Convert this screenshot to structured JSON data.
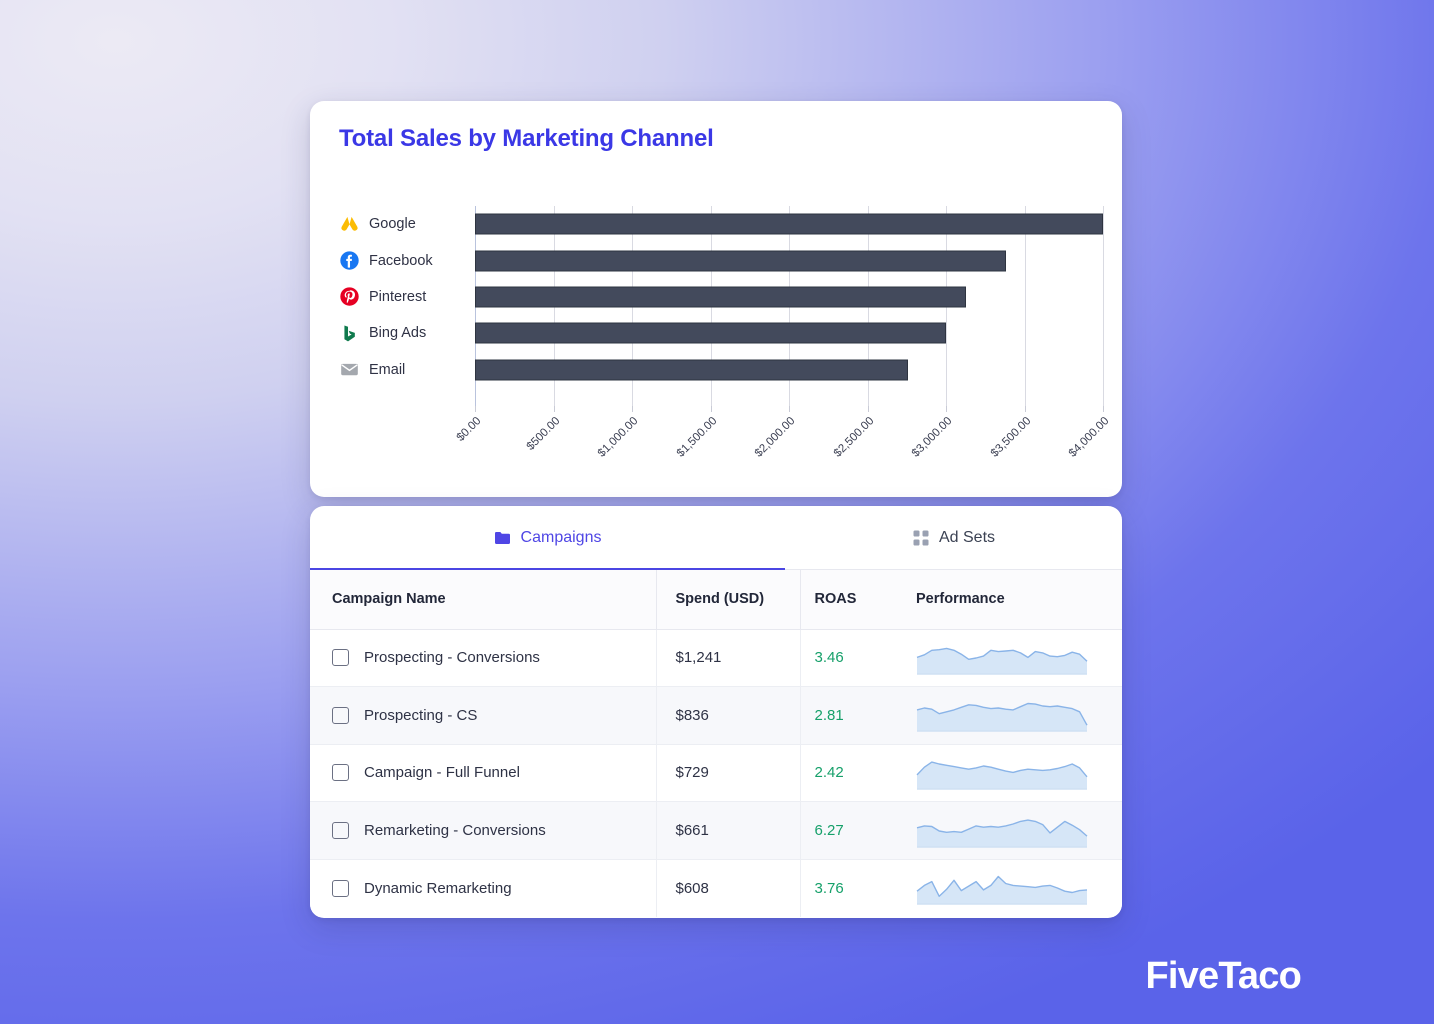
{
  "brand": {
    "logo_text": "FiveTaco"
  },
  "theme": {
    "accent": "#4b46e3",
    "title_color": "#3b38e6",
    "bar_color": "#434a5c",
    "roas_color": "#16a06a",
    "spark_stroke": "#8ab4e8",
    "spark_fill": "#d6e6f7"
  },
  "chart_card": {
    "title": "Total Sales by Marketing Channel"
  },
  "chart_data": {
    "type": "bar",
    "orientation": "horizontal",
    "title": "Total Sales by Marketing Channel",
    "xlabel": "",
    "ylabel": "",
    "categories": [
      "Google",
      "Facebook",
      "Pinterest",
      "Bing Ads",
      "Email"
    ],
    "values": [
      4000,
      3380,
      3130,
      3000,
      2760
    ],
    "icons": [
      "google-ads-icon",
      "facebook-icon",
      "pinterest-icon",
      "bing-icon",
      "email-icon"
    ],
    "xlim": [
      0,
      4000
    ],
    "xtick_values": [
      0,
      500,
      1000,
      1500,
      2000,
      2500,
      3000,
      3500,
      4000
    ],
    "xtick_labels": [
      "$0.00",
      "$500.00",
      "$1,000.00",
      "$1,500.00",
      "$2,000.00",
      "$2,500.00",
      "$3,000.00",
      "$3,500.00",
      "$4,000.00"
    ],
    "grid": true,
    "legend": false,
    "tick_label_rotation": -45
  },
  "tabs": [
    {
      "label": "Campaigns",
      "icon": "folder-icon",
      "active": true
    },
    {
      "label": "Ad Sets",
      "icon": "grid-icon",
      "active": false
    }
  ],
  "table": {
    "columns": [
      "Campaign Name",
      "Spend (USD)",
      "ROAS",
      "Performance"
    ],
    "rows": [
      {
        "name": "Prospecting - Conversions",
        "spend": "$1,241",
        "roas": "3.46",
        "sparkline": [
          52,
          60,
          74,
          76,
          80,
          74,
          62,
          46,
          50,
          56,
          74,
          70,
          72,
          74,
          66,
          52,
          70,
          66,
          56,
          54,
          58,
          68,
          62,
          40
        ]
      },
      {
        "name": "Prospecting - CS",
        "spend": "$836",
        "roas": "2.81",
        "sparkline": [
          66,
          72,
          68,
          54,
          60,
          66,
          74,
          82,
          80,
          74,
          70,
          72,
          68,
          66,
          76,
          86,
          84,
          78,
          76,
          78,
          74,
          70,
          60,
          18
        ]
      },
      {
        "name": "Campaign - Full Funnel",
        "spend": "$729",
        "roas": "2.42",
        "sparkline": [
          44,
          68,
          84,
          78,
          74,
          70,
          66,
          62,
          66,
          72,
          68,
          62,
          56,
          52,
          58,
          62,
          60,
          58,
          60,
          64,
          70,
          78,
          66,
          38
        ]
      },
      {
        "name": "Remarketing - Conversions",
        "spend": "$661",
        "roas": "6.27",
        "sparkline": [
          60,
          66,
          64,
          50,
          46,
          48,
          46,
          56,
          66,
          62,
          64,
          62,
          66,
          72,
          80,
          84,
          80,
          70,
          44,
          62,
          80,
          68,
          54,
          34
        ]
      },
      {
        "name": "Dynamic Remarketing",
        "spend": "$608",
        "roas": "3.76",
        "sparkline": [
          40,
          58,
          70,
          24,
          46,
          74,
          42,
          56,
          70,
          44,
          58,
          86,
          64,
          58,
          56,
          54,
          52,
          56,
          58,
          50,
          40,
          36,
          42,
          44
        ]
      }
    ]
  }
}
